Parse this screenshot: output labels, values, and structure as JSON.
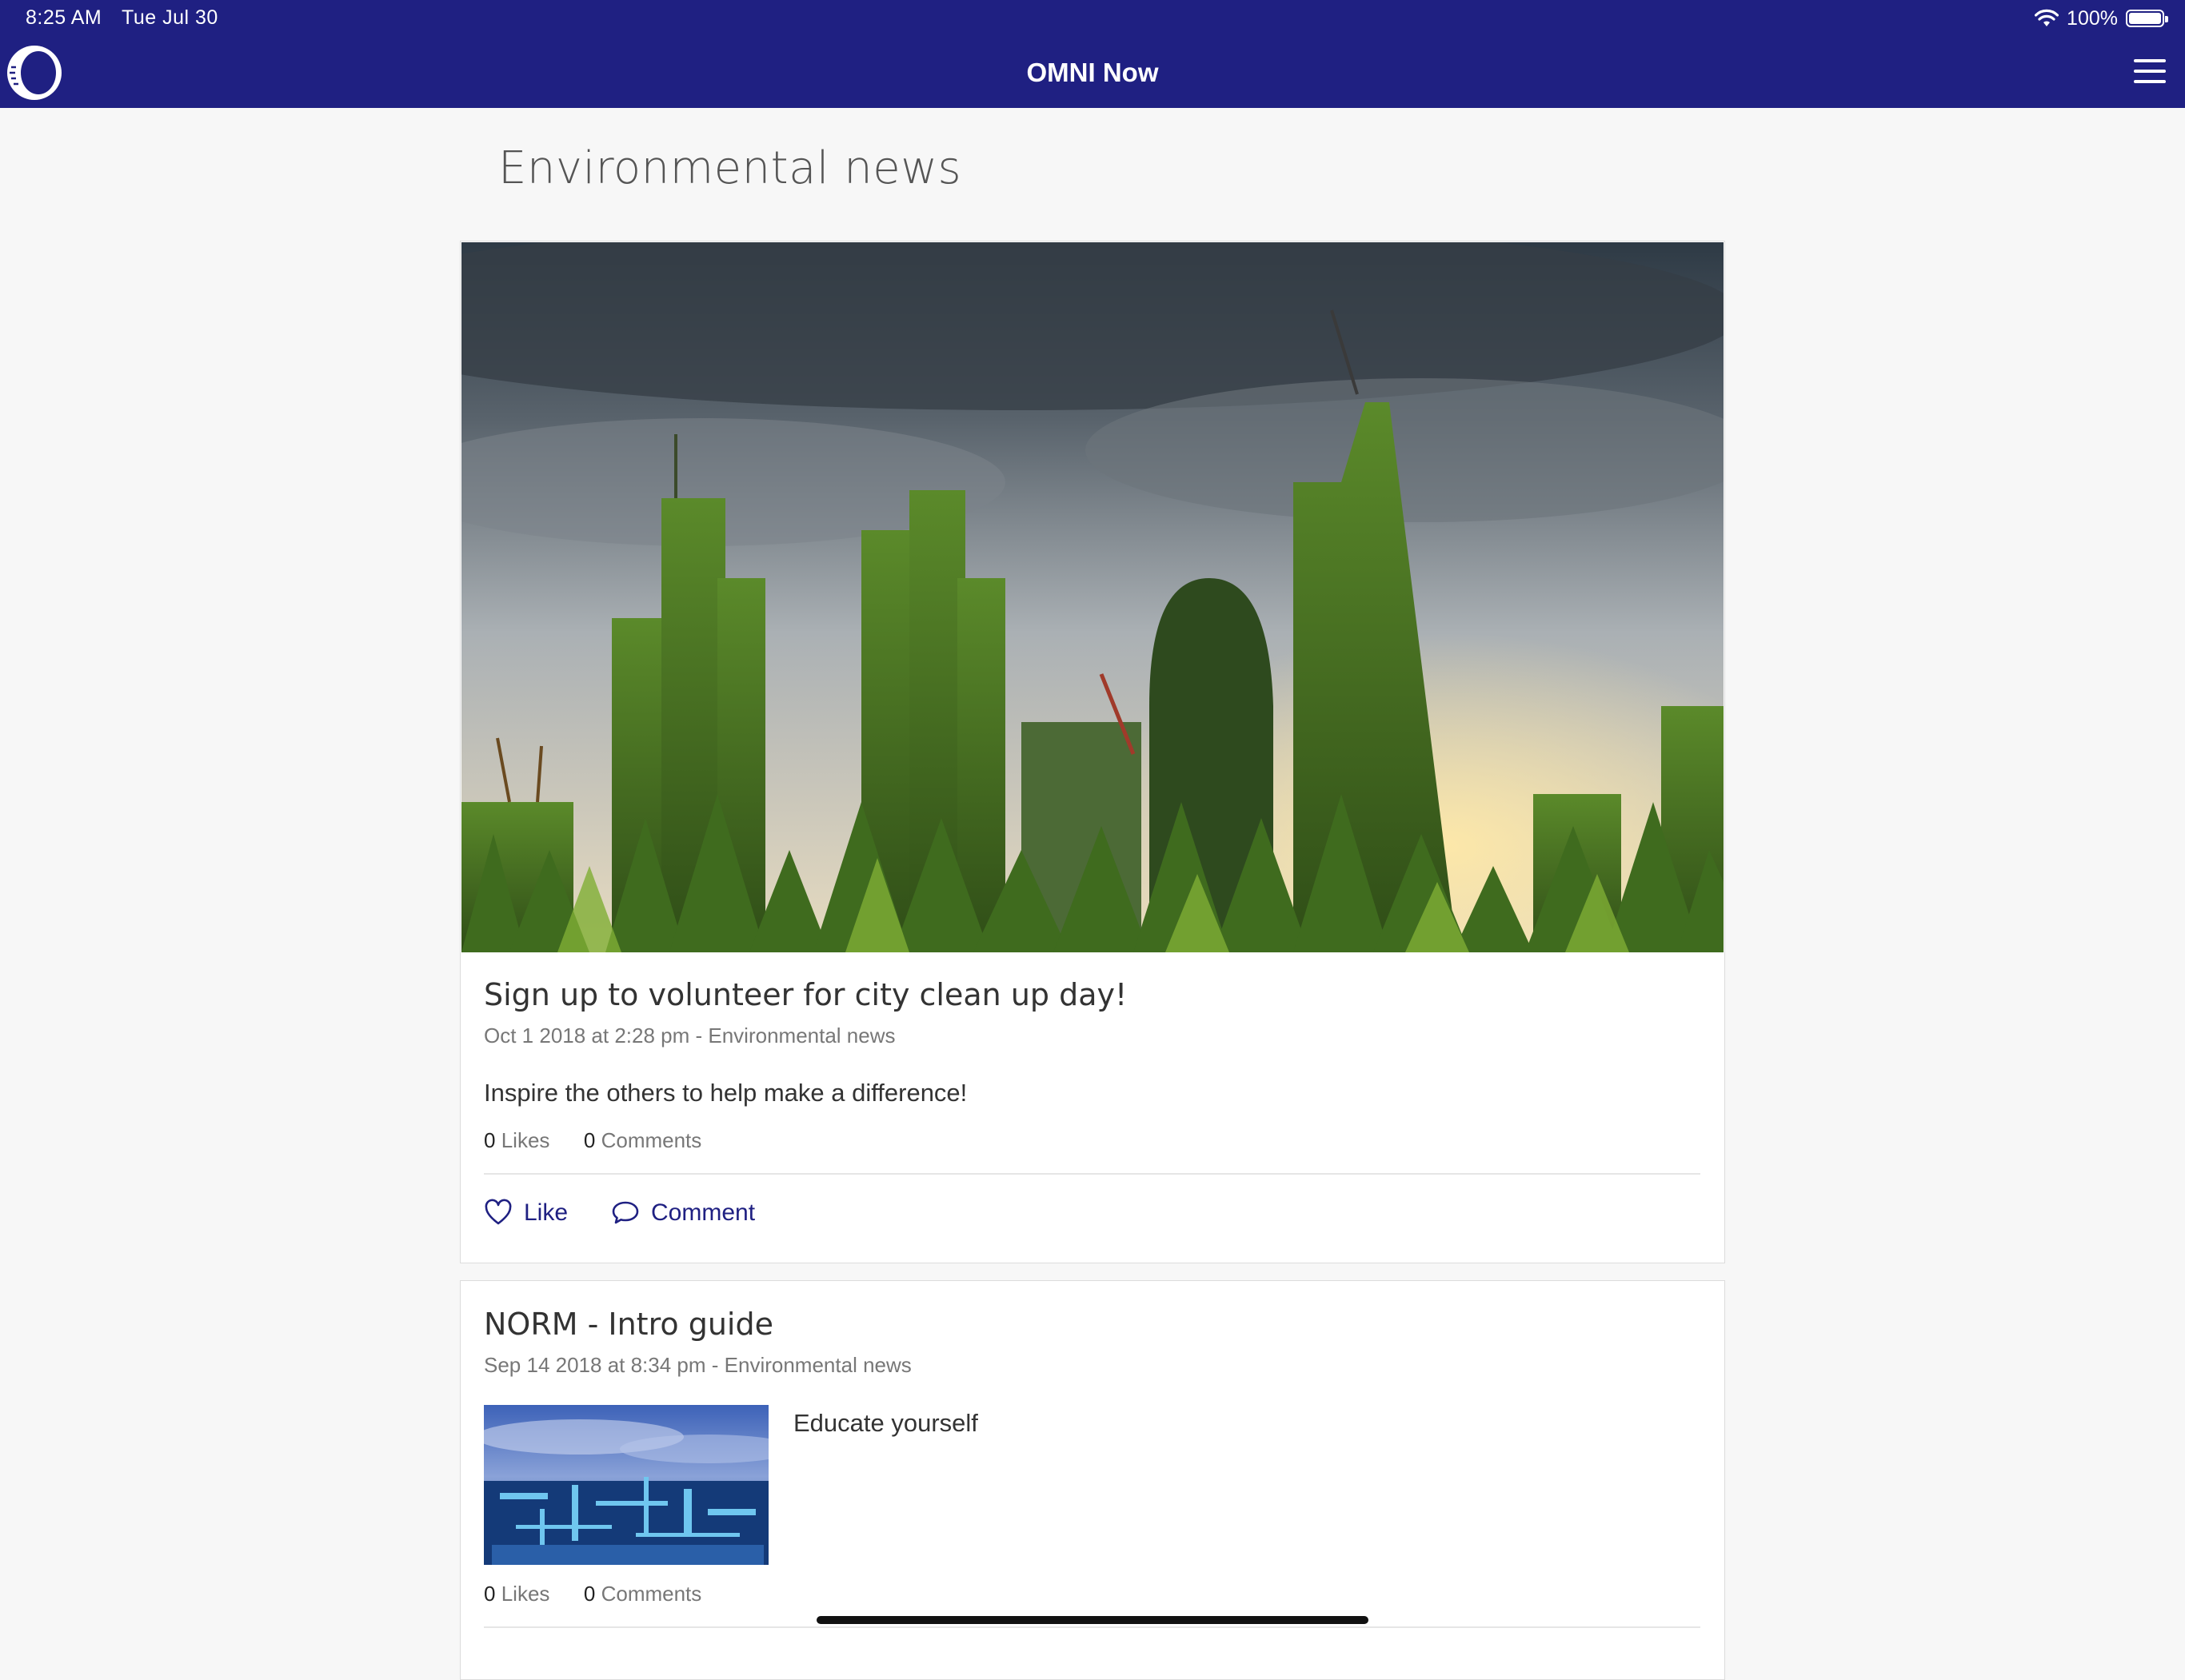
{
  "status_bar": {
    "time": "8:25 AM",
    "date": "Tue Jul 30",
    "battery": "100%",
    "battery_level": 1.0,
    "icons": [
      "wifi-icon",
      "battery-icon"
    ]
  },
  "app": {
    "title": "OMNI Now",
    "logo_icon": "omni-logo-icon",
    "menu_icon": "hamburger-menu-icon"
  },
  "page": {
    "title": "Environmental news"
  },
  "posts": [
    {
      "title": "Sign up to volunteer for city clean up day!",
      "meta": "Oct 1 2018 at 2:28 pm - Environmental news",
      "body": "Inspire the others to help make a difference!",
      "likes_count": "0",
      "likes_label": "Likes",
      "comments_count": "0",
      "comments_label": "Comments",
      "like_action": "Like",
      "comment_action": "Comment"
    },
    {
      "title": "NORM - Intro guide",
      "meta": "Sep 14 2018 at 8:34 pm - Environmental news",
      "body": "Educate yourself",
      "likes_count": "0",
      "likes_label": "Likes",
      "comments_count": "0",
      "comments_label": "Comments"
    }
  ],
  "colors": {
    "brand": "#1f2082",
    "background": "#f7f7f7",
    "card": "#ffffff"
  }
}
